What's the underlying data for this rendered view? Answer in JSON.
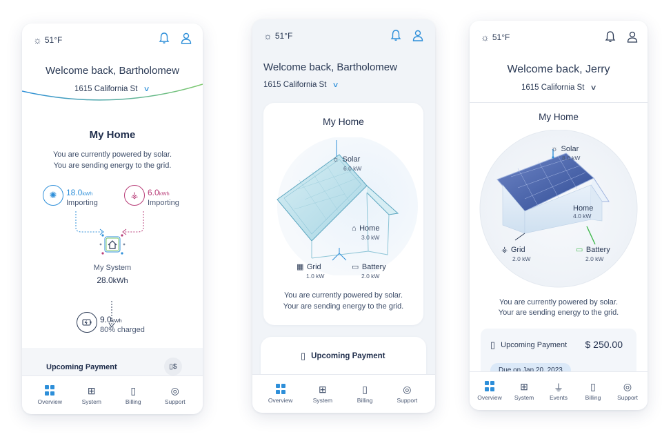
{
  "phone1": {
    "weather": "51°F",
    "welcome": "Welcome back, Bartholomew",
    "address": "1615 California St",
    "title": "My Home",
    "status_line1": "You are currently powered by solar.",
    "status_line2": "You are sending energy to the grid.",
    "solar": {
      "value": "18.0",
      "unit": "kWh",
      "label": "Importing"
    },
    "grid": {
      "value": "6.0",
      "unit": "kWh",
      "label": "Importing"
    },
    "system": {
      "label": "My System",
      "value": "28.0",
      "unit": "kWh"
    },
    "battery": {
      "value": "9.0",
      "unit": "kWh",
      "label": "80% charged"
    },
    "payment_label": "Upcoming Payment",
    "nav": [
      "Overview",
      "System",
      "Billing",
      "Support"
    ]
  },
  "phone2": {
    "weather": "51°F",
    "welcome": "Welcome back, Bartholomew",
    "address": "1615 California St",
    "title": "My Home",
    "solar": {
      "label": "Solar",
      "value": "6.0 kW"
    },
    "home": {
      "label": "Home",
      "value": "3.0 kW"
    },
    "grid": {
      "label": "Grid",
      "value": "1.0 kW"
    },
    "battery": {
      "label": "Battery",
      "value": "2.0 kW"
    },
    "status_line1": "You are currently powered by solar.",
    "status_line2": "Your are sending energy to the grid.",
    "payment_label": "Upcoming Payment",
    "nav": [
      "Overview",
      "System",
      "Billing",
      "Support"
    ]
  },
  "phone3": {
    "weather": "51°F",
    "welcome": "Welcome back, Jerry",
    "address": "1615 California St",
    "title": "My Home",
    "solar": {
      "label": "Solar",
      "value": "8.0 kW"
    },
    "home": {
      "label": "Home",
      "value": "4.0 kW"
    },
    "grid": {
      "label": "Grid",
      "value": "2.0 kW"
    },
    "battery": {
      "label": "Battery",
      "value": "2.0 kW"
    },
    "status_line1": "You are currently powered by solar.",
    "status_line2": "Your are sending energy to the grid.",
    "payment_label": "Upcoming Payment",
    "payment_amount": "$ 250.00",
    "due": "Due on Jan 20, 2023",
    "nav": [
      "Overview",
      "System",
      "Events",
      "Billing",
      "Support"
    ]
  },
  "colors": {
    "accent": "#2e8fd9",
    "solar": "#2e8fd9",
    "grid": "#b83d78",
    "battery": "#3db84a",
    "text": "#2b3a55"
  }
}
